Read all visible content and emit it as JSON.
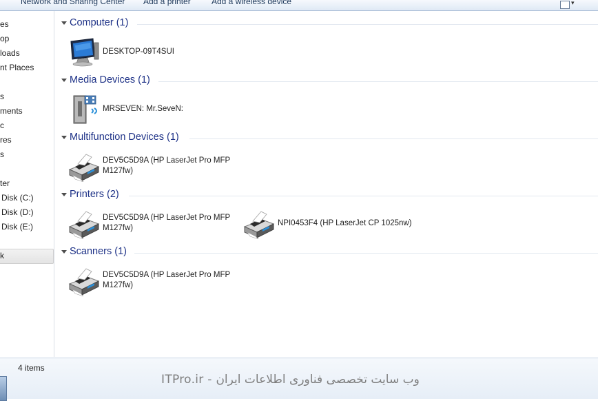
{
  "toolbar": {
    "network_sharing": "Network and Sharing Center",
    "add_printer": "Add a printer",
    "add_wireless": "Add a wireless device"
  },
  "nav": {
    "items": [
      "es",
      "op",
      "loads",
      "nt Places",
      "s",
      "ments",
      "c",
      "res",
      "s",
      "ter",
      "Disk (C:)",
      "Disk (D:)",
      "Disk (E:)",
      "k"
    ]
  },
  "groups": {
    "computer": {
      "title": "Computer (1)",
      "devices": [
        {
          "name": "DESKTOP-09T4SUI"
        }
      ]
    },
    "media": {
      "title": "Media Devices (1)",
      "devices": [
        {
          "name": "MRSEVEN: Mr.SeveN:"
        }
      ]
    },
    "multifunction": {
      "title": "Multifunction Devices (1)",
      "devices": [
        {
          "name": "DEV5C5D9A (HP LaserJet Pro MFP M127fw)"
        }
      ]
    },
    "printers": {
      "title": "Printers (2)",
      "devices": [
        {
          "name": "DEV5C5D9A (HP LaserJet Pro MFP M127fw)"
        },
        {
          "name": "NPI0453F4 (HP LaserJet CP 1025nw)"
        }
      ]
    },
    "scanners": {
      "title": "Scanners (1)",
      "devices": [
        {
          "name": "DEV5C5D9A (HP LaserJet Pro MFP M127fw)"
        }
      ]
    }
  },
  "status": {
    "count": "4 items"
  },
  "watermark": "ITPro.ir - وب سایت تخصصی فناوری اطلاعات ایران",
  "icons": {
    "computer": "computer-monitor-icon",
    "media": "media-server-icon",
    "printer": "printer-icon",
    "view": "view-options-icon"
  },
  "colors": {
    "group_title": "#1e3287",
    "toolbar_text": "#1e395b",
    "selection": "#e4e4e4"
  }
}
